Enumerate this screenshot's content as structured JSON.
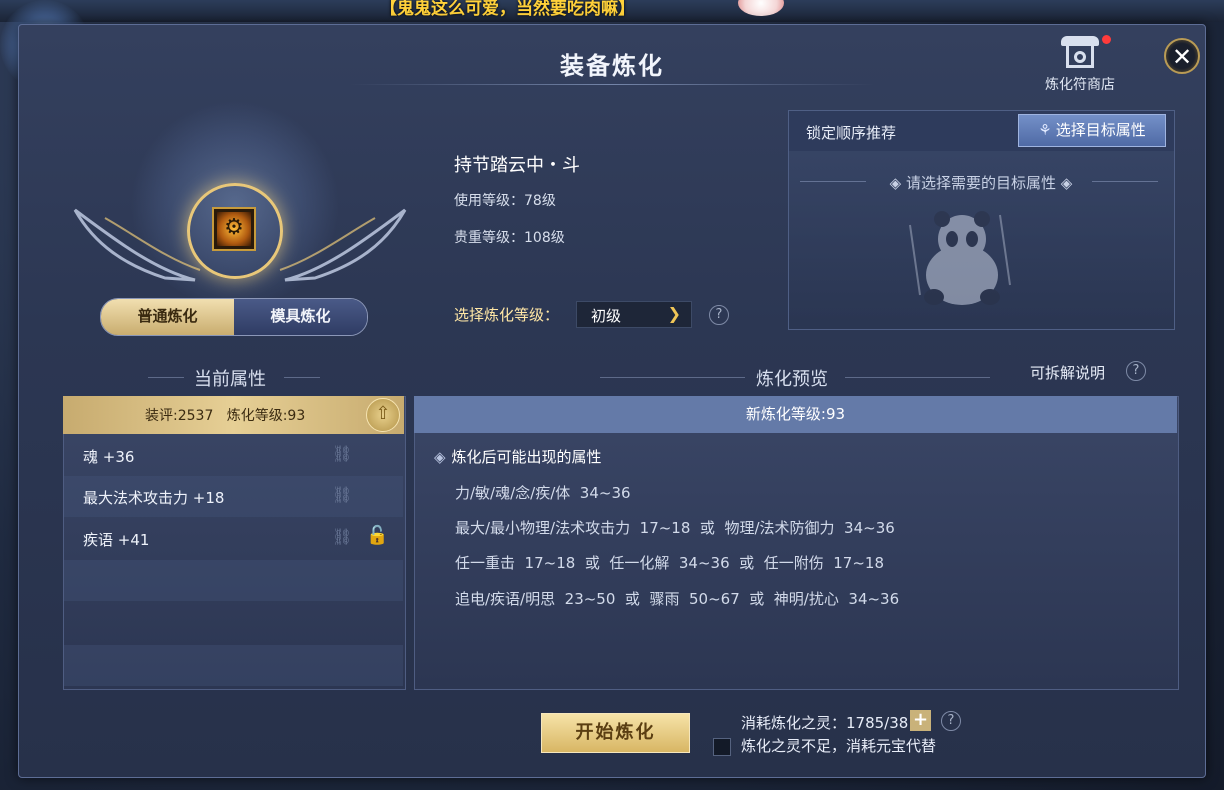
{
  "window": {
    "title": "装备炼化",
    "top_banner": "【鬼鬼这么可爱，当然要吃肉嘛】",
    "close_label": "✕"
  },
  "shop": {
    "label": "炼化符商店",
    "has_notification": true,
    "notification_color": "#ff3b3b"
  },
  "mode_tabs": [
    {
      "label": "普通炼化",
      "active": true
    },
    {
      "label": "模具炼化",
      "active": false
    }
  ],
  "item": {
    "name": "持节踏云中・斗",
    "use_level": "使用等级：78级",
    "value_level": "贵重等级：108级",
    "icon": "armor-icon"
  },
  "grade": {
    "label": "选择炼化等级：",
    "selected": "初级"
  },
  "target": {
    "header_label": "锁定顺序推荐",
    "button_label": "选择目标属性",
    "hint": "请选择需要的目标属性",
    "placeholder_icon": "panda-icon"
  },
  "current": {
    "section_title": "当前属性",
    "header": "装评:2537   炼化等级:93",
    "attributes": [
      {
        "name": "魂 +36",
        "locked": false
      },
      {
        "name": "最大法术攻击力 +18",
        "locked": false
      },
      {
        "name": "疾语 +41",
        "locked": false,
        "lock_toggle": true
      }
    ]
  },
  "preview": {
    "section_title": "炼化预览",
    "disassemble_label": "可拆解说明",
    "header": "新炼化等级:93",
    "subtitle": "炼化后可能出现的属性",
    "lines": [
      "力/敏/魂/念/疾/体  34~36",
      "最大/最小物理/法术攻击力  17~18  或  物理/法术防御力  34~36",
      "任一重击  17~18  或  任一化解  34~36  或  任一附伤  17~18",
      "追电/疾语/明思  23~50  或  骤雨  50~67  或  神明/扰心  34~36"
    ]
  },
  "footer": {
    "start_label": "开始炼化",
    "consume_text": "消耗炼化之灵：1785/38",
    "substitute_text": "炼化之灵不足，消耗元宝代替",
    "substitute_checked": false
  },
  "colors": {
    "gold_accent": "#e8c779",
    "panel_bg": "#2c3753",
    "preview_header": "#647aa8",
    "grade_label": "#ffe7a6"
  }
}
